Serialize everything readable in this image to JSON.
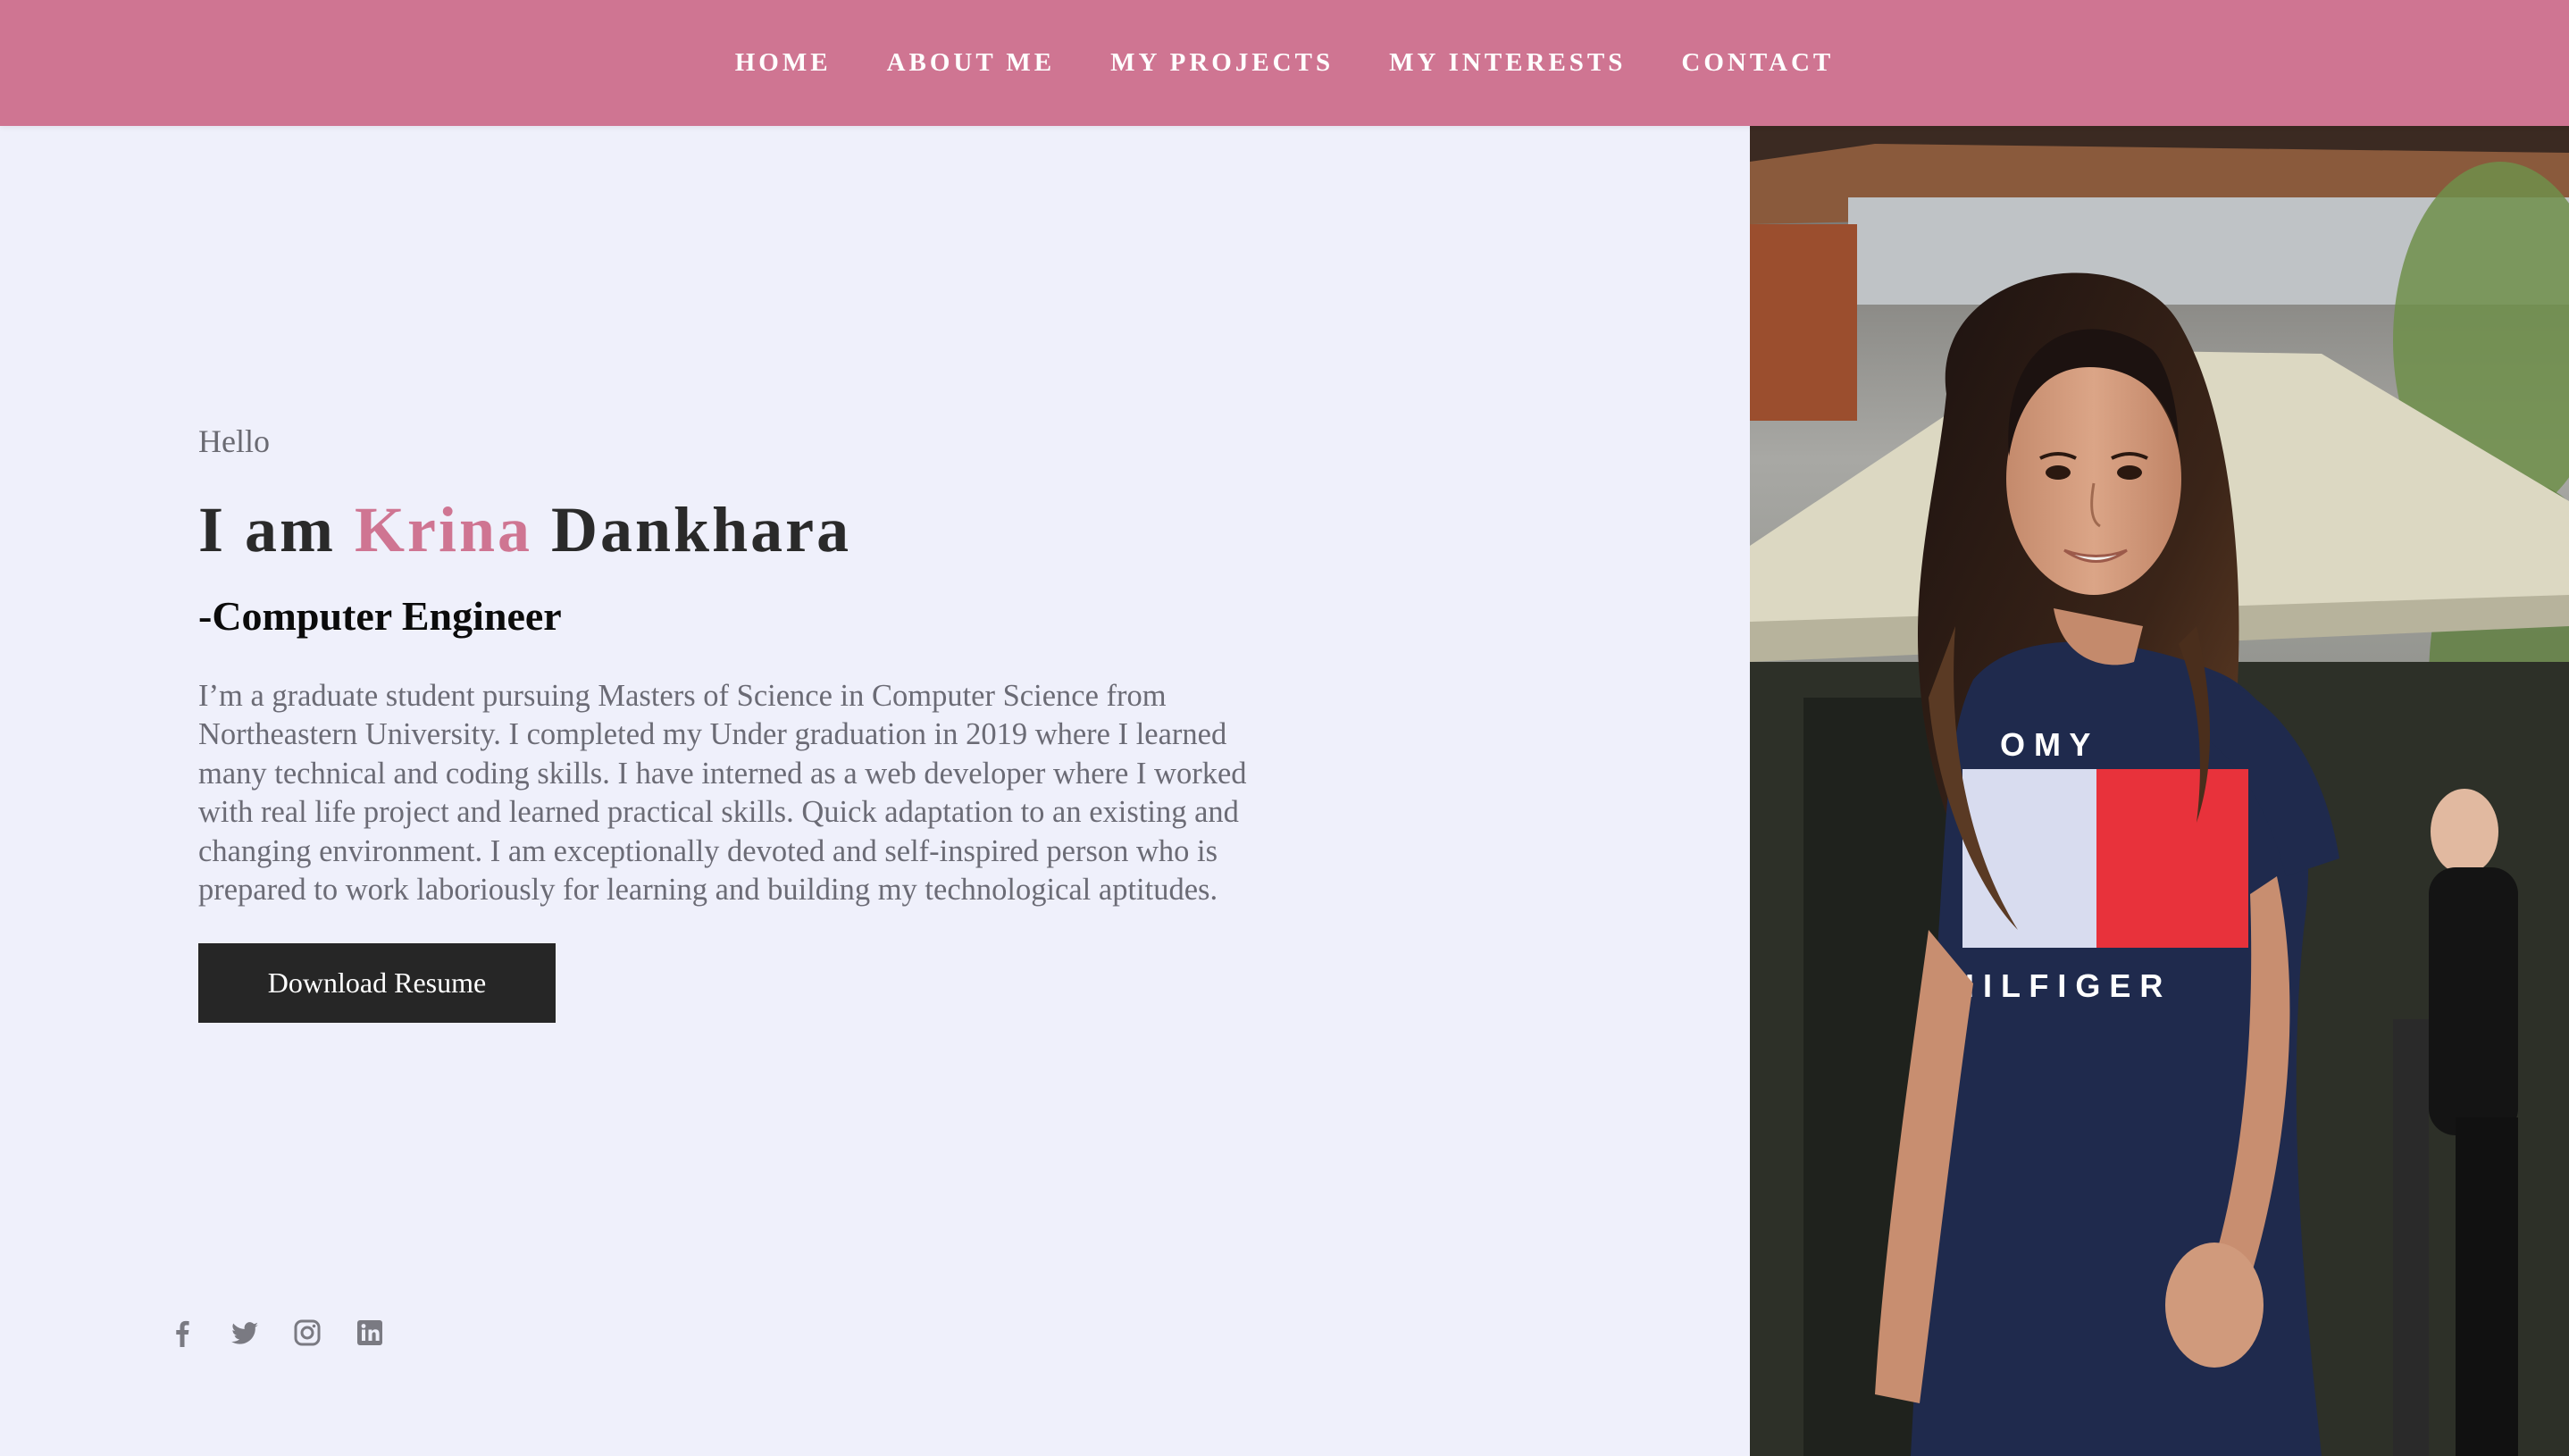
{
  "nav": {
    "items": [
      {
        "label": "HOME"
      },
      {
        "label": "ABOUT ME"
      },
      {
        "label": "MY PROJECTS"
      },
      {
        "label": "MY INTERESTS"
      },
      {
        "label": "CONTACT"
      }
    ]
  },
  "hero": {
    "greeting": "Hello",
    "headline_prefix": "I am",
    "first_name": "Krina",
    "last_name": "Dankhara",
    "role": "-Computer Engineer",
    "bio": "I’m a graduate student pursuing Masters of Science in Computer Science from Northeastern University. I completed my Under graduation in 2019 where I learned many technical and coding skills. I have interned as a web developer where I worked with real life project and learned practical skills. Quick adaptation to an existing and changing environment. I am exceptionally devoted and self-inspired person who is prepared to work laboriously for learning and building my technological aptitudes.",
    "button_label": "Download Resume"
  },
  "social": [
    "facebook-icon",
    "twitter-icon",
    "instagram-icon",
    "linkedin-icon"
  ],
  "photo": {
    "shirt_text_top": "O M Y",
    "shirt_text_bottom": "H I L F I G E R"
  },
  "colors": {
    "nav_bg": "#cf7592",
    "accent": "#cf7592",
    "page_bg": "#eff0fb",
    "button_bg": "#262626",
    "text_muted": "#6b6b75",
    "social_icon": "#7a7a82"
  }
}
